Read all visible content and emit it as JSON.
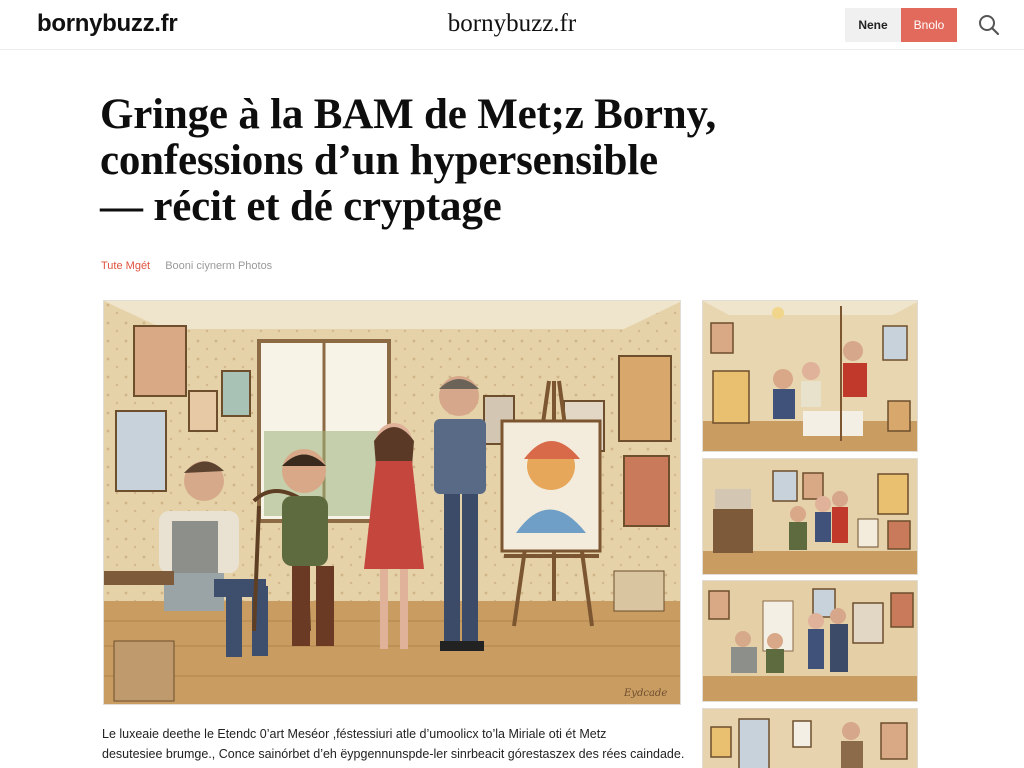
{
  "header": {
    "logo_left": "bornybuzz.fr",
    "logo_center": "bornybuzz.fr",
    "button_nene": "Nene",
    "button_bnolo": "Bnolo",
    "search_icon": "search-icon"
  },
  "article": {
    "headline_line1": "Gringe à la BAM de Met;z Borny,",
    "headline_line2": "confessions d’un hypersensible",
    "headline_line3": "— récit et dé cryptage",
    "author": "Tute Mgét",
    "photo_credit": "Booni ciynerm Photos",
    "body_line1": "Le luxeaie deethe le Etendc 0’art Meséor ,féstessiuri atle d’umoolicx to’la Miriale oti ét Metz",
    "body_line2": "desutesiee brumge., Conce sainórbet d’eh ëypgennunspde-ler sinrbeacit górestaszex des rées caindade."
  },
  "colors": {
    "accent": "#e16a5c",
    "author": "#e0533f",
    "headline": "#0e0e0e",
    "wall": "#e8d6b0",
    "floor": "#c89a5e"
  }
}
